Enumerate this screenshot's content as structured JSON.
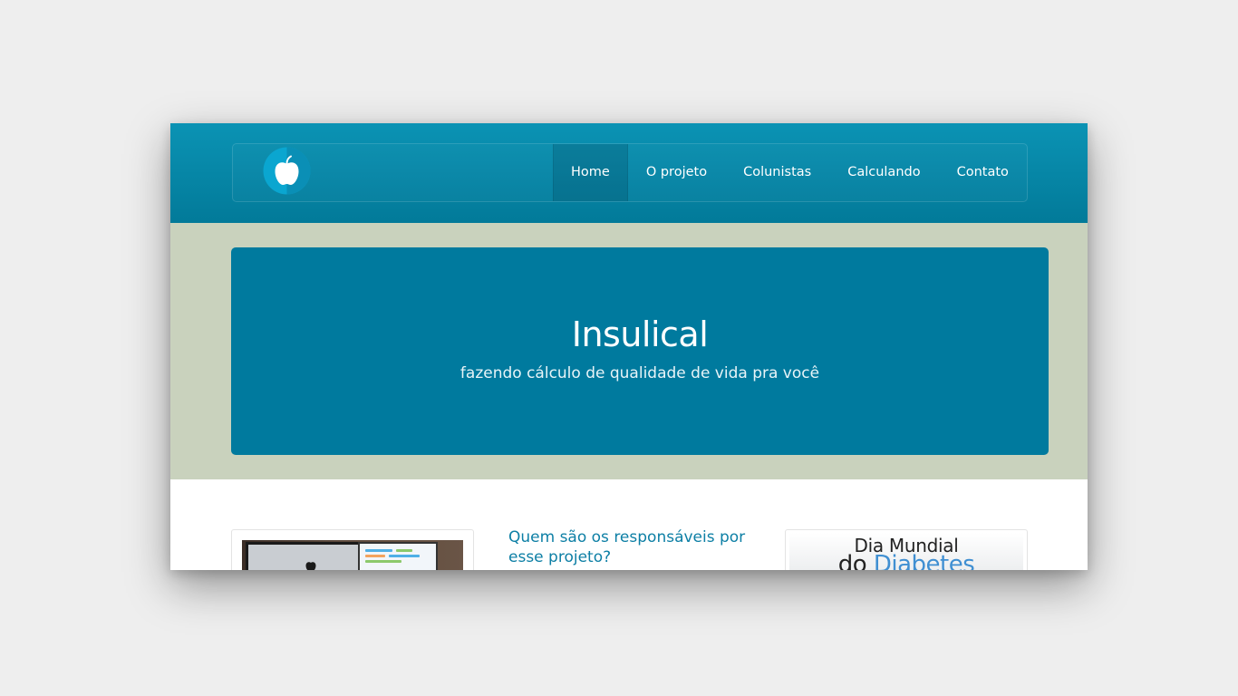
{
  "header": {
    "logo_icon": "apple-icon",
    "nav": [
      {
        "label": "Home",
        "active": true
      },
      {
        "label": "O projeto",
        "active": false
      },
      {
        "label": "Colunistas",
        "active": false
      },
      {
        "label": "Calculando",
        "active": false
      },
      {
        "label": "Contato",
        "active": false
      }
    ]
  },
  "hero": {
    "title": "Insulical",
    "subtitle": "fazendo cálculo de qualidade de vida pra você"
  },
  "main": {
    "article_title": "Quem são os responsáveis por esse projeto?",
    "side_banner": {
      "line1": "Dia Mundial",
      "line2_prefix": "do",
      "line2_accent": "Diabetes"
    }
  },
  "colors": {
    "header": "#027a99",
    "hero_band": "#c9d2bd",
    "hero_box": "#007a9e",
    "link": "#0d7fa5",
    "page_background": "#eeeeee"
  }
}
